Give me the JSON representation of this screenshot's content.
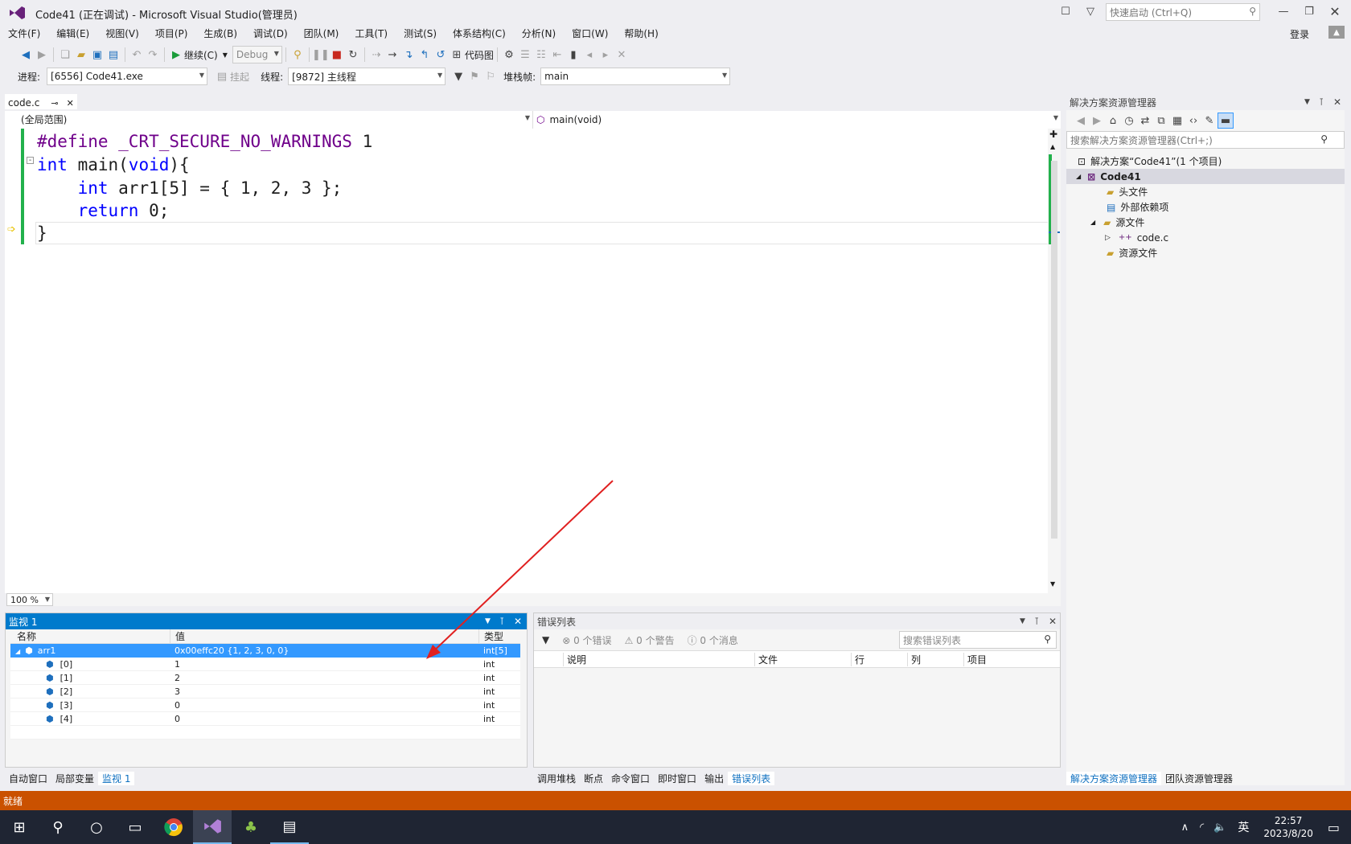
{
  "window": {
    "title": "Code41 (正在调试) - Microsoft Visual Studio(管理员)",
    "quick_launch_placeholder": "快速启动 (Ctrl+Q)",
    "login": "登录"
  },
  "menu": [
    "文件(F)",
    "编辑(E)",
    "视图(V)",
    "项目(P)",
    "生成(B)",
    "调试(D)",
    "团队(M)",
    "工具(T)",
    "测试(S)",
    "体系结构(C)",
    "分析(N)",
    "窗口(W)",
    "帮助(H)"
  ],
  "toolbar": {
    "continue_label": "继续(C)",
    "config": "Debug",
    "codemap_label": "代码图"
  },
  "debugbar": {
    "process_label": "进程:",
    "process_value": "[6556] Code41.exe",
    "suspend_label": "挂起",
    "thread_label": "线程:",
    "thread_value": "[9872] 主线程",
    "stack_label": "堆栈帧:",
    "stack_value": "main"
  },
  "editor": {
    "tab": "code.c",
    "scope": "(全局范围)",
    "function": "main(void)",
    "zoom": "100 %",
    "lines": [
      [
        {
          "t": "#define ",
          "c": "pp"
        },
        {
          "t": "_CRT_SECURE_NO_WARNINGS",
          "c": "pp"
        },
        {
          "t": " 1",
          "c": "num"
        }
      ],
      [
        {
          "t": "int",
          "c": "kw"
        },
        {
          "t": " main(",
          "c": "num"
        },
        {
          "t": "void",
          "c": "kw"
        },
        {
          "t": "){",
          "c": "num"
        }
      ],
      [
        {
          "t": "    ",
          "c": "num"
        },
        {
          "t": "int",
          "c": "kw"
        },
        {
          "t": " arr1[5] = { 1, 2, 3 };",
          "c": "num"
        }
      ],
      [
        {
          "t": "    ",
          "c": "num"
        },
        {
          "t": "return",
          "c": "kw"
        },
        {
          "t": " 0;",
          "c": "num"
        }
      ],
      [
        {
          "t": "}",
          "c": "num"
        }
      ]
    ]
  },
  "watch": {
    "title": "监视 1",
    "columns": [
      "名称",
      "值",
      "类型"
    ],
    "rows": [
      {
        "name": "arr1",
        "value": "0x00effc20 {1, 2, 3, 0, 0}",
        "type": "int[5]"
      },
      {
        "name": "[0]",
        "value": "1",
        "type": "int"
      },
      {
        "name": "[1]",
        "value": "2",
        "type": "int"
      },
      {
        "name": "[2]",
        "value": "3",
        "type": "int"
      },
      {
        "name": "[3]",
        "value": "0",
        "type": "int"
      },
      {
        "name": "[4]",
        "value": "0",
        "type": "int"
      }
    ],
    "tabs": [
      "自动窗口",
      "局部变量",
      "监视 1"
    ]
  },
  "errors": {
    "title": "错误列表",
    "errors": "0 个错误",
    "warnings": "0 个警告",
    "messages": "0 个消息",
    "search_placeholder": "搜索错误列表",
    "columns": [
      "说明",
      "文件",
      "行",
      "列",
      "项目"
    ],
    "tabs": [
      "调用堆栈",
      "断点",
      "命令窗口",
      "即时窗口",
      "输出",
      "错误列表"
    ]
  },
  "solution": {
    "title": "解决方案资源管理器",
    "search_placeholder": "搜索解决方案资源管理器(Ctrl+;)",
    "root": "解决方案“Code41”(1 个项目)",
    "project": "Code41",
    "items": [
      "头文件",
      "外部依赖项",
      "源文件",
      "code.c",
      "资源文件"
    ],
    "tabs": [
      "解决方案资源管理器",
      "团队资源管理器"
    ]
  },
  "status": "就绪",
  "taskbar": {
    "ime": "英",
    "time": "22:57",
    "date": "2023/8/20"
  },
  "colors": {
    "accent": "#007acc",
    "status": "#ca5100",
    "arrow": "#e02020"
  }
}
